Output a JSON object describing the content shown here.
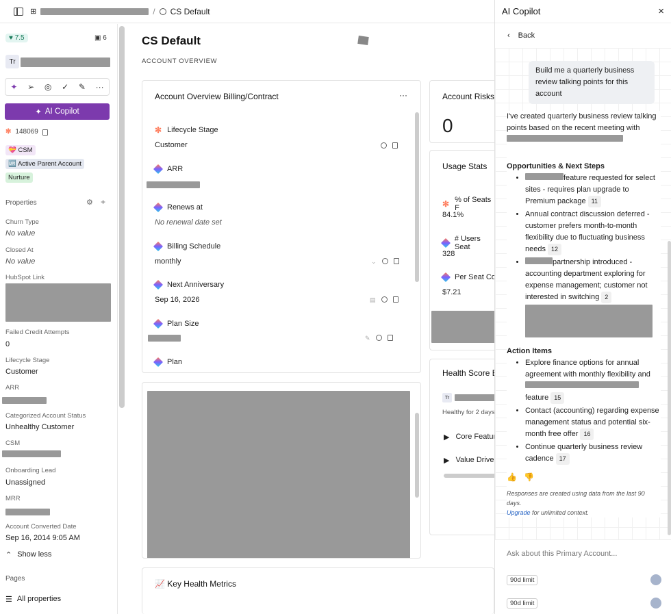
{
  "topbar": {
    "page_label": "CS Default"
  },
  "sidebar": {
    "score": "7.5",
    "count": "6",
    "avatar_initials": "Tr",
    "copilot_label": "AI Copilot",
    "id_value": "148069",
    "tags": [
      "💝 CSM",
      "🆙 Active Parent Account",
      "Nurture"
    ],
    "properties_label": "Properties",
    "fields": [
      {
        "label": "Churn Type",
        "value": "No value"
      },
      {
        "label": "Closed At",
        "value": "No value"
      },
      {
        "label": "HubSpot Link",
        "value": ""
      },
      {
        "label": "Failed Credit Attempts",
        "value": "0"
      },
      {
        "label": "Lifecycle Stage",
        "value": "Customer"
      },
      {
        "label": "ARR",
        "value": ""
      },
      {
        "label": "Categorized Account Status",
        "value": "Unhealthy Customer"
      },
      {
        "label": "CSM",
        "value": ""
      },
      {
        "label": "Onboarding Lead",
        "value": "Unassigned"
      },
      {
        "label": "MRR",
        "value": ""
      },
      {
        "label": "Account Converted Date",
        "value": "Sep 16, 2014 9:05 AM"
      }
    ],
    "show_less": "Show less",
    "pages_label": "Pages",
    "all_properties": "All properties"
  },
  "main": {
    "title": "CS Default",
    "subtitle": "ACCOUNT OVERVIEW",
    "billing_card": {
      "title": "Account Overview Billing/Contract",
      "more": "···",
      "fields": [
        {
          "label": "Lifecycle Stage",
          "value": "Customer"
        },
        {
          "label": "ARR",
          "value": ""
        },
        {
          "label": "Renews at",
          "value": "No renewal date set"
        },
        {
          "label": "Billing Schedule",
          "value": "monthly"
        },
        {
          "label": "Next Anniversary",
          "value": "Sep 16, 2026"
        },
        {
          "label": "Plan Size",
          "value": ""
        },
        {
          "label": "Plan",
          "value": ""
        }
      ]
    },
    "risks_card": {
      "title": "Account Risks",
      "value": "0"
    },
    "usage_card": {
      "title": "Usage Stats",
      "rows": [
        {
          "label": "% of Seats F",
          "value": "84.1%"
        },
        {
          "label": "# Users Seat",
          "value": "328"
        },
        {
          "label": "Per Seat Co",
          "value": "$7.21"
        }
      ]
    },
    "health_card": {
      "title": "Health Score B",
      "avatar": "Tr",
      "healthy_for": "Healthy for 2 days",
      "sections": [
        "Core Featur",
        "Value Drive"
      ]
    },
    "metrics_card": {
      "title": "📈 Key Health Metrics"
    }
  },
  "copilot": {
    "title": "AI Copilot",
    "close": "×",
    "back": "Back",
    "user_message": "Build me a quarterly business review talking points for this account",
    "intro": "I've created quarterly business review talking points based on the recent meeting with",
    "section1": "Opportunities & Next Steps",
    "items1": [
      {
        "text": "feature requested for select sites - requires plan upgrade to Premium package",
        "ref": "11"
      },
      {
        "text": "Annual contract discussion deferred - customer prefers month-to-month flexibility due to fluctuating business needs",
        "ref": "12"
      },
      {
        "text": "partnership introduced - accounting department exploring for expense management; customer not interested in switching",
        "ref": "2"
      }
    ],
    "section2": "Action Items",
    "items2": [
      {
        "text": "Explore finance options for annual agreement with monthly flexibility and",
        "tail": "feature",
        "ref": "15"
      },
      {
        "text": "Contact (accounting) regarding expense management status and potential six-month free offer",
        "ref": "16"
      },
      {
        "text": "Continue quarterly business review cadence",
        "ref": "17"
      }
    ],
    "footnote_1": "Responses are created using data from the last 90 days.",
    "footnote_link": "Upgrade",
    "footnote_2": " for unlimited context.",
    "input_placeholder": "Ask about this Primary Account...",
    "limit_label": "90d limit"
  },
  "colors": {
    "accent": "#7c3aad",
    "hubspot": "#ff7a59"
  }
}
